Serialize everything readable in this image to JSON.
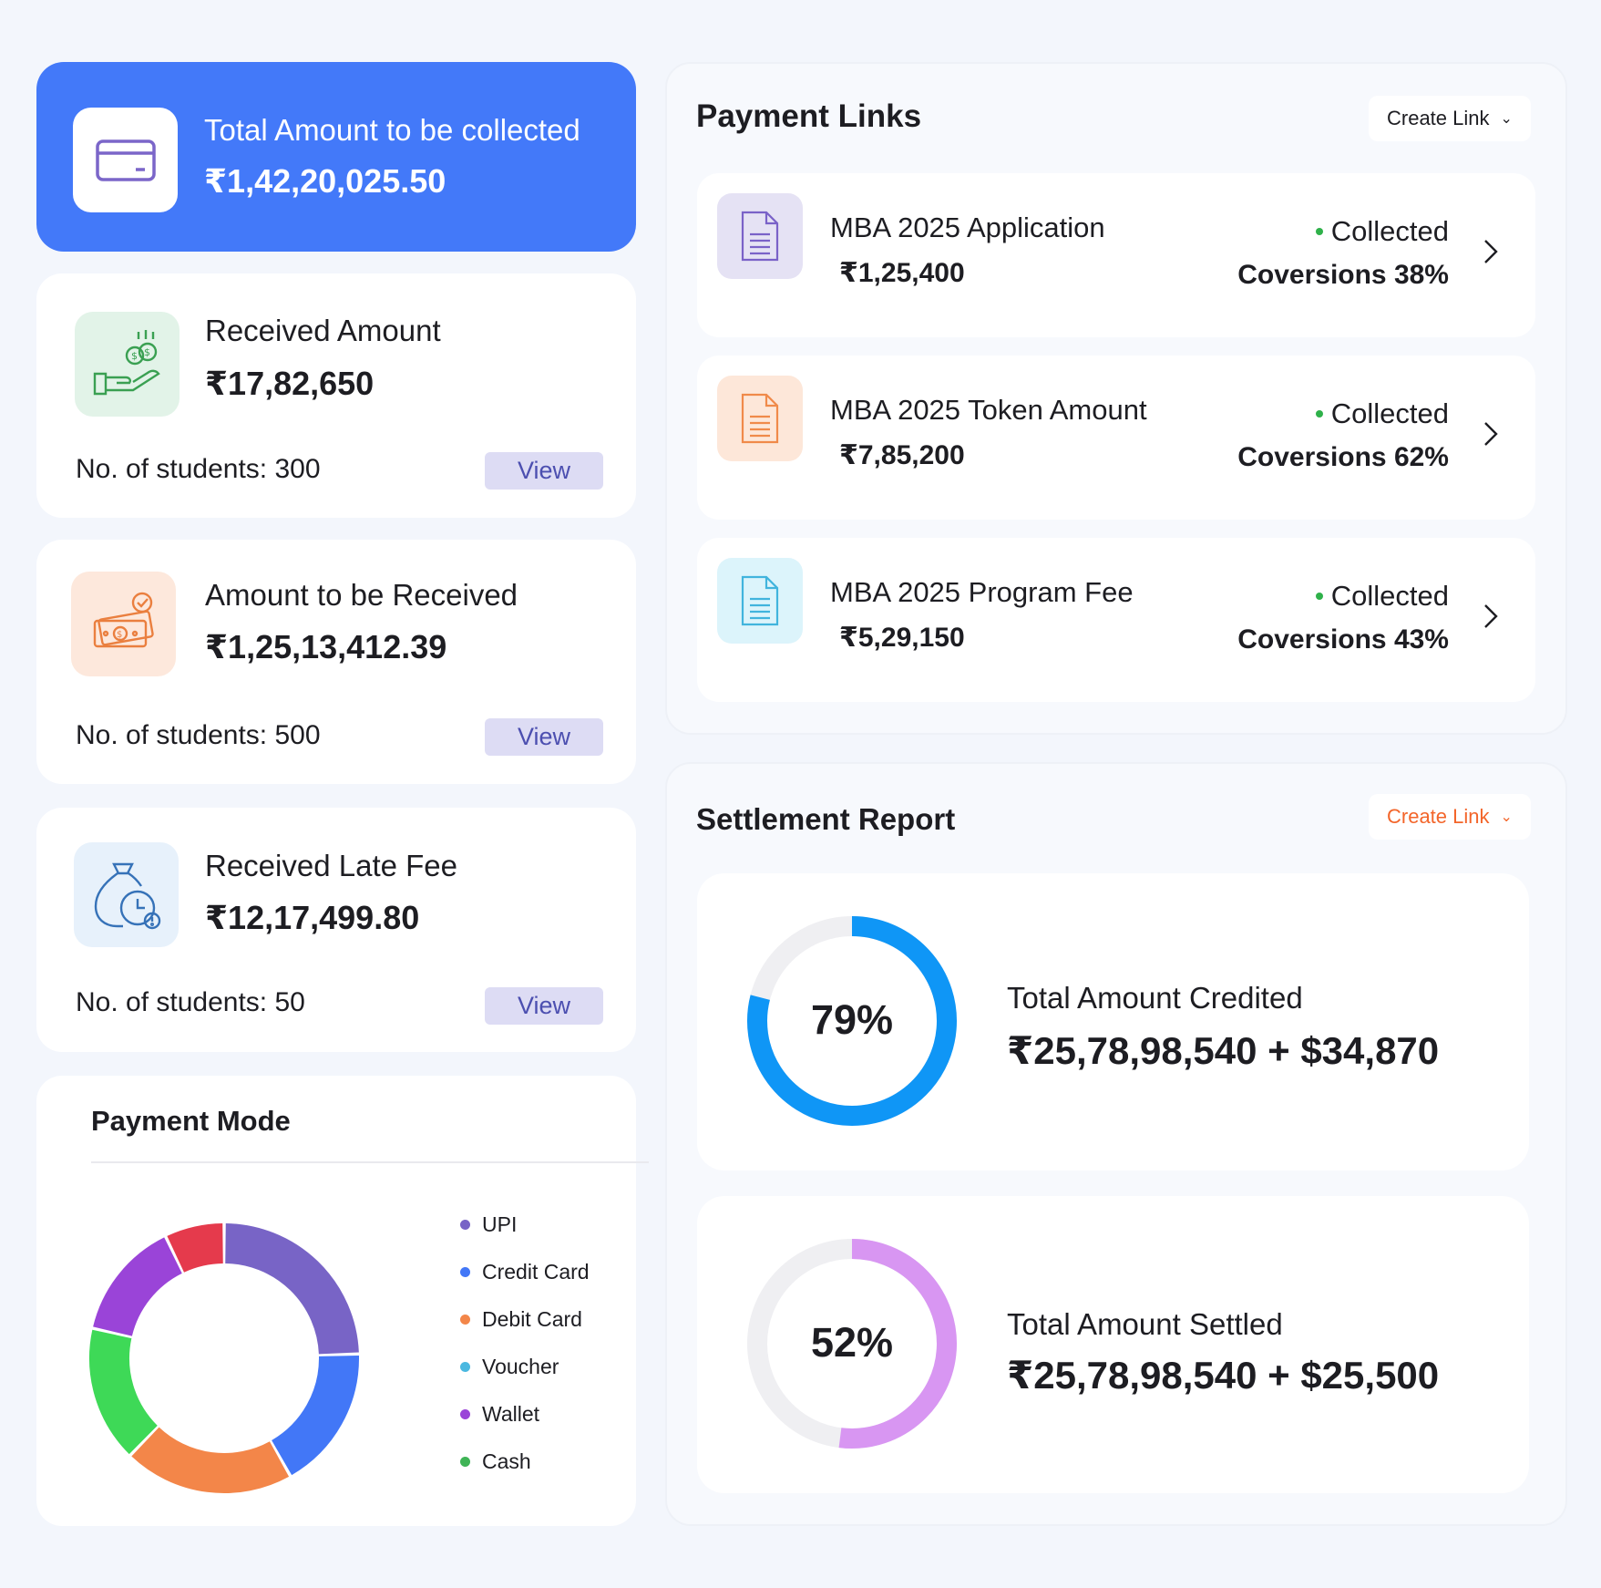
{
  "total_card": {
    "label": "Total Amount to be collected",
    "value": "₹1,42,20,025.50"
  },
  "stats": [
    {
      "label": "Received Amount",
      "value": "₹17,82,650",
      "students": "No. of students: 300",
      "view_label": "View",
      "icon": "money-hand-icon"
    },
    {
      "label": "Amount to be Received",
      "value": "₹1,25,13,412.39",
      "students": "No. of students: 500",
      "view_label": "View",
      "icon": "cash-check-icon"
    },
    {
      "label": "Received Late Fee",
      "value": "₹12,17,499.80",
      "students": "No. of students: 50",
      "view_label": "View",
      "icon": "money-bag-clock-icon"
    }
  ],
  "payment_mode": {
    "title": "Payment Mode"
  },
  "payment_links": {
    "title": "Payment Links",
    "create_label": "Create Link",
    "items": [
      {
        "name": "MBA 2025 Application",
        "amount": "₹1,25,400",
        "status": "Collected",
        "conversion": "Coversions 38%",
        "icon_color": "#7a62c8",
        "icon_bg": "#e5e2f4"
      },
      {
        "name": "MBA 2025 Token Amount",
        "amount": "₹7,85,200",
        "status": "Collected",
        "conversion": "Coversions 62%",
        "icon_color": "#f08a4a",
        "icon_bg": "#fde7d9"
      },
      {
        "name": "MBA 2025 Program Fee",
        "amount": "₹5,29,150",
        "status": "Collected",
        "conversion": "Coversions 43%",
        "icon_color": "#41b4dd",
        "icon_bg": "#dcf4fb"
      }
    ]
  },
  "settlement": {
    "title": "Settlement Report",
    "create_label": "Create Link",
    "create_color": "#f3652a",
    "cards": [
      {
        "percent_label": "79%",
        "percent": 79,
        "label": "Total Amount Credited",
        "value": "₹25,78,98,540 + $34,870",
        "color": "#0f96f6"
      },
      {
        "percent_label": "52%",
        "percent": 52,
        "label": "Total Amount Settled",
        "value": "₹25,78,98,540 + $25,500",
        "color": "#d896f2"
      }
    ]
  },
  "chart_data": {
    "type": "pie",
    "title": "Payment Mode",
    "categories": [
      "UPI",
      "Credit Card",
      "Debit Card",
      "Voucher",
      "Wallet",
      "Cash"
    ],
    "values": [
      25,
      17,
      21,
      0,
      14,
      7
    ],
    "extra_slices": [
      {
        "name": "",
        "value": 16,
        "color": "#3ed957"
      }
    ],
    "colors": [
      "#7864c6",
      "#4277f7",
      "#f38649",
      "#4ab8e0",
      "#9a44d8",
      "#3fb456"
    ],
    "slice_colors": [
      "#7864c6",
      "#4277f7",
      "#f38649",
      "#3ed957",
      "#9a44d8",
      "#e53a4c"
    ],
    "slice_values": [
      24,
      17,
      20,
      16,
      14,
      7
    ],
    "legend_position": "right"
  }
}
